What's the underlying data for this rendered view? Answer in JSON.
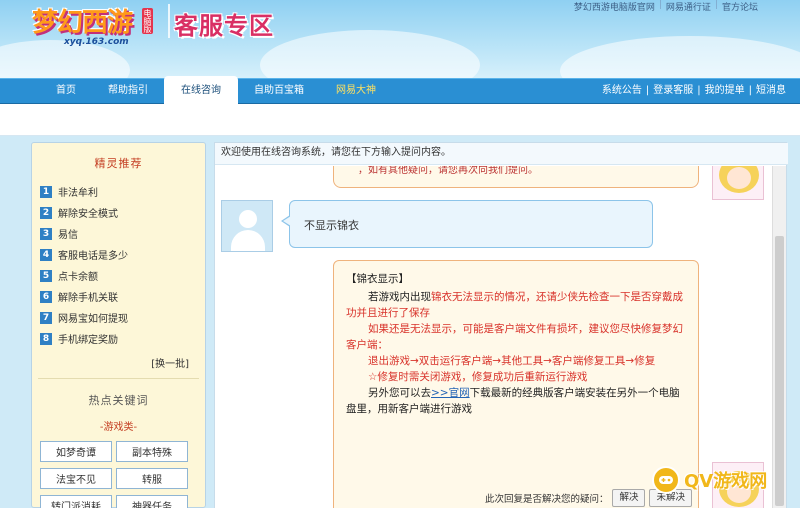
{
  "header": {
    "logo_text": "梦幻西游",
    "logo_badge": "电脑版",
    "logo_url": "xyq.163.com",
    "site_title": "客服专区",
    "top_links": [
      "梦幻西游电脑版官网",
      "网易通行证",
      "官方论坛"
    ]
  },
  "nav": {
    "tabs": [
      "首页",
      "帮助指引",
      "在线咨询",
      "自助百宝箱",
      "网易大神"
    ],
    "right_links": [
      "系统公告",
      "登录客服",
      "我的提单",
      "短消息"
    ]
  },
  "sidebar": {
    "title": "精灵推荐",
    "items": [
      {
        "num": "1",
        "label": "非法牟利"
      },
      {
        "num": "2",
        "label": "解除安全模式"
      },
      {
        "num": "3",
        "label": "易信"
      },
      {
        "num": "4",
        "label": "客服电话是多少"
      },
      {
        "num": "5",
        "label": "点卡余额"
      },
      {
        "num": "6",
        "label": "解除手机关联"
      },
      {
        "num": "7",
        "label": "网易宝如何提现"
      },
      {
        "num": "8",
        "label": "手机绑定奖励"
      }
    ],
    "refresh": "[换一批]",
    "hot_title": "热点关键词",
    "hot_sub": "-游戏类-",
    "keywords": [
      "如梦奇谭",
      "副本特殊",
      "法宝不见",
      "转服",
      "转门派消耗",
      "神器任务"
    ]
  },
  "main": {
    "welcome": "欢迎使用在线咨询系统，请您在下方输入提问内容。",
    "prev_reply_fragment": "，如有其他疑问，请您再次向我们提问。",
    "user_message": "不显示锦衣",
    "reply": {
      "title": "【锦衣显示】",
      "p1_a": "若游戏内出现",
      "p1_b": "锦衣无法显示的情况，还请少侠先检查一下是否穿戴成功并且进行了保存",
      "p2": "如果还是无法显示，可能是客户端文件有损坏，建议您尽快修复梦幻客户端：",
      "p3": "退出游戏→双击运行客户端→其他工具→客户端修复工具→修复",
      "p4": "☆修复时需关闭游戏，修复成功后重新运行游戏",
      "p5_a": "另外您可以去",
      "p5_link": ">>官网",
      "p5_b": "下载最新的经典版客户端安装在另外一个电脑盘里，用新客户端进行游戏"
    },
    "feedback": {
      "question": "此次回复是否解决您的疑问：",
      "resolved": "解决",
      "unresolved": "未解决"
    }
  },
  "watermark": "QV游戏网",
  "colors": {
    "nav_blue": "#2a8fd3",
    "reply_red": "#d8322a",
    "title_pink": "#d92f64"
  }
}
